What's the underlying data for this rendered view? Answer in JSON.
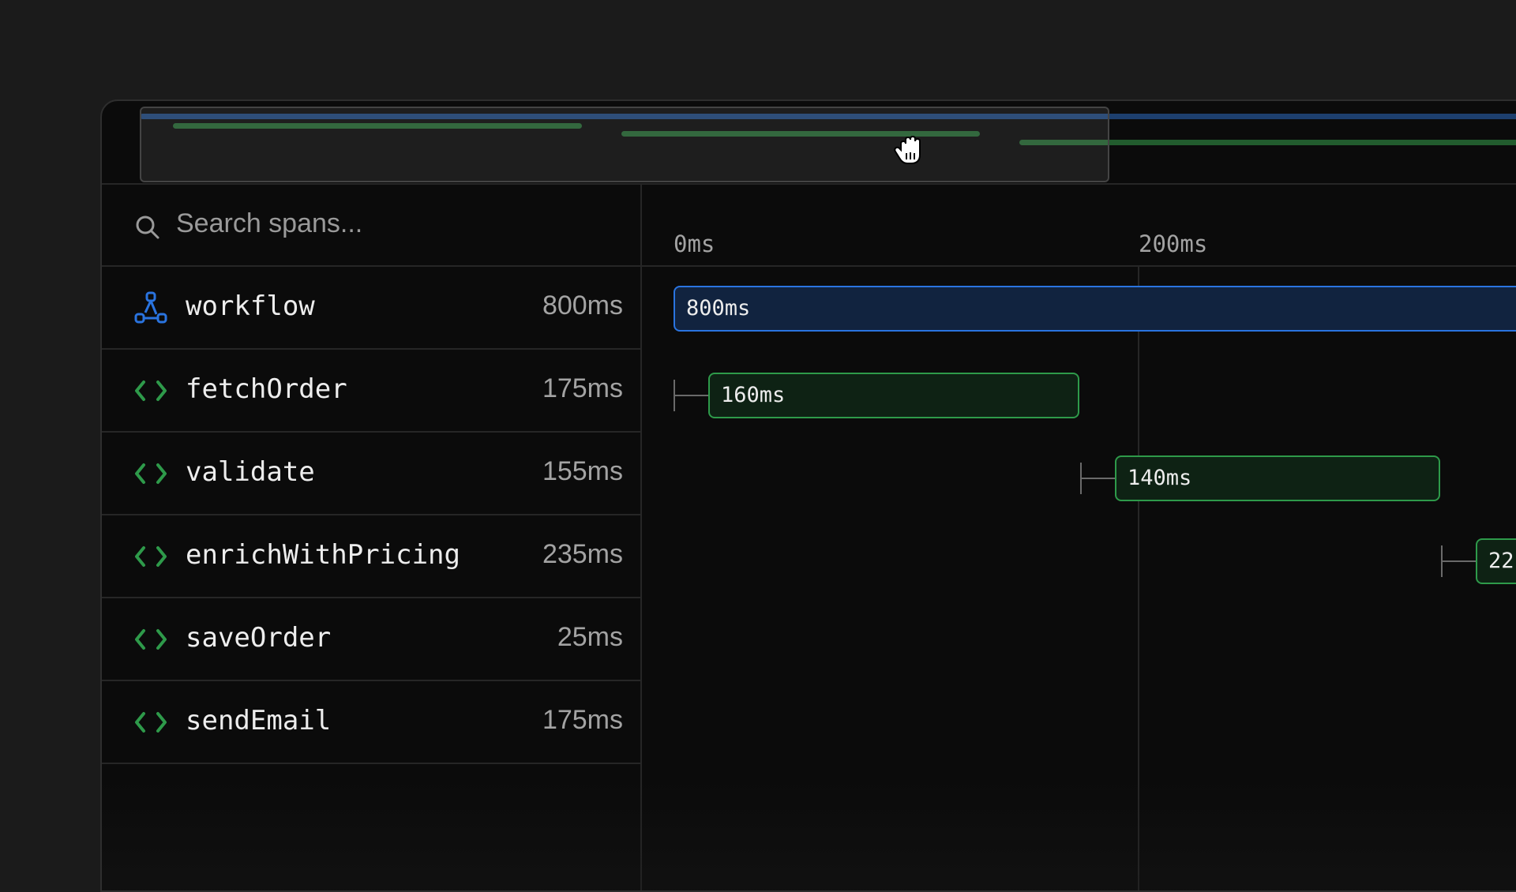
{
  "colors": {
    "background": "#1b1b1b",
    "panel": "#0b0b0b",
    "workflow_accent": "#2a74e0",
    "step_accent": "#2e9a4a"
  },
  "search": {
    "icon": "search-icon",
    "placeholder": "Search spans..."
  },
  "spans": [
    {
      "name": "workflow",
      "duration": "800ms",
      "icon": "workflow-icon"
    },
    {
      "name": "fetchOrder",
      "duration": "175ms",
      "icon": "code-icon"
    },
    {
      "name": "validate",
      "duration": "155ms",
      "icon": "code-icon"
    },
    {
      "name": "enrichWithPricing",
      "duration": "235ms",
      "icon": "code-icon"
    },
    {
      "name": "saveOrder",
      "duration": "25ms",
      "icon": "code-icon"
    },
    {
      "name": "sendEmail",
      "duration": "175ms",
      "icon": "code-icon"
    }
  ],
  "timeline": {
    "ticks": [
      "0ms",
      "200ms"
    ],
    "bars": [
      {
        "label": "800ms"
      },
      {
        "label": "160ms"
      },
      {
        "label": "140ms"
      },
      {
        "label": "22"
      }
    ]
  },
  "cursor": "hand-grab-cursor-icon"
}
